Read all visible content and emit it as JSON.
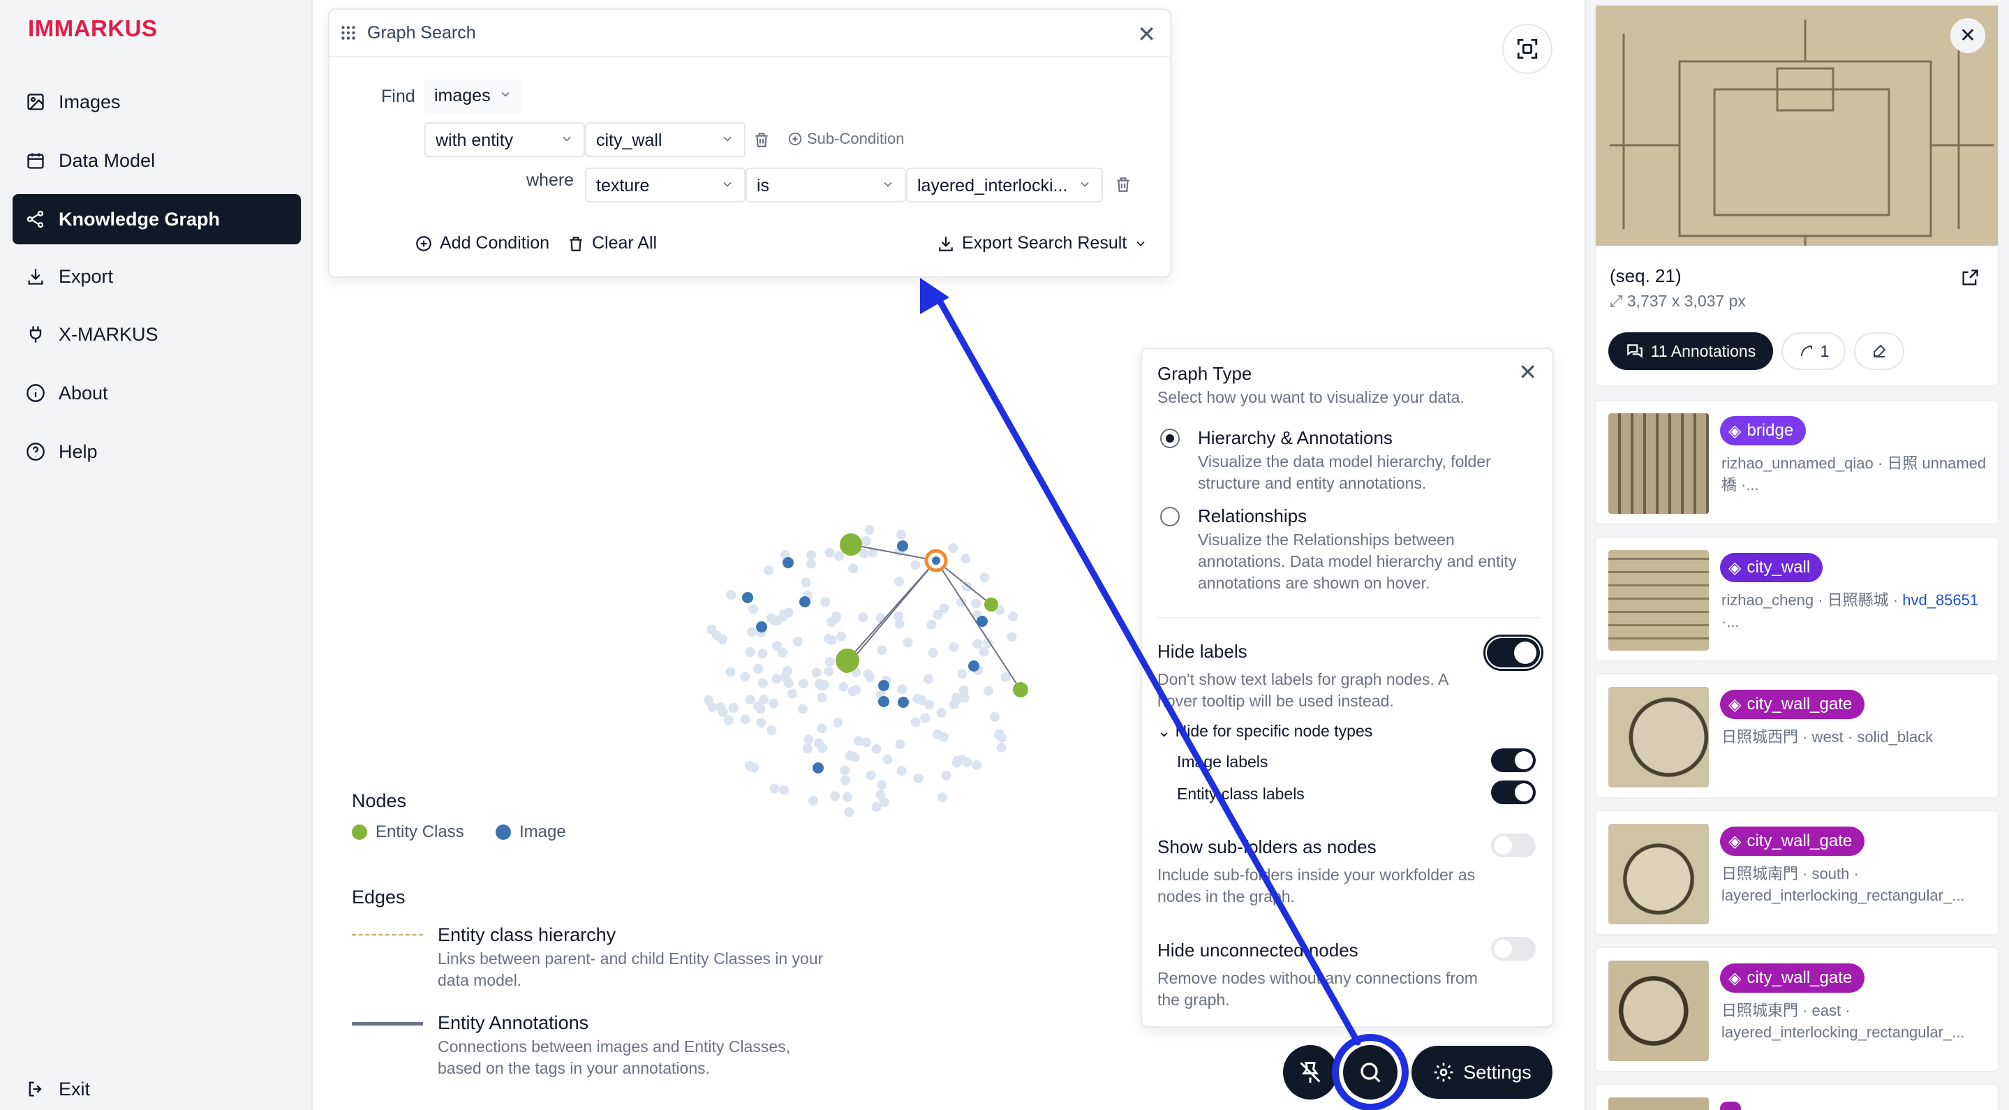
{
  "app": {
    "name": "IMMARKUS"
  },
  "sidebar": {
    "items": [
      {
        "label": "Images",
        "icon": "image-icon"
      },
      {
        "label": "Data Model",
        "icon": "calendar-icon"
      },
      {
        "label": "Knowledge Graph",
        "icon": "graph-icon",
        "active": true
      },
      {
        "label": "Export",
        "icon": "download-icon"
      },
      {
        "label": "X-MARKUS",
        "icon": "plug-icon"
      },
      {
        "label": "About",
        "icon": "info-icon"
      },
      {
        "label": "Help",
        "icon": "help-icon"
      }
    ],
    "exit_label": "Exit"
  },
  "search": {
    "title": "Graph Search",
    "find_label": "Find",
    "find_value": "images",
    "with_entity": "with entity",
    "entity_value": "city_wall",
    "sub_condition": "Sub-Condition",
    "where_label": "where",
    "property": "texture",
    "operator": "is",
    "value": "layered_interlocki...",
    "add_condition": "Add Condition",
    "clear_all": "Clear All",
    "export": "Export Search Result"
  },
  "legend": {
    "nodes_title": "Nodes",
    "entity_class": "Entity Class",
    "image": "Image",
    "edges_title": "Edges",
    "hierarchy_title": "Entity class hierarchy",
    "hierarchy_desc": "Links between parent- and child Entity Classes in your data model.",
    "annotations_title": "Entity Annotations",
    "annotations_desc": "Connections between images and Entity Classes, based on the tags in your annotations."
  },
  "graph_type": {
    "title": "Graph Type",
    "subtitle": "Select how you want to visualize your data.",
    "option1_title": "Hierarchy & Annotations",
    "option1_desc": "Visualize the data model hierarchy, folder structure and entity annotations.",
    "option2_title": "Relationships",
    "option2_desc": "Visualize the Relationships between annotations. Data model hierarchy and entity annotations are shown on hover.",
    "hide_labels_title": "Hide labels",
    "hide_labels_desc": "Don't show text labels for graph nodes. A hover tooltip will be used instead.",
    "specific_types": "Hide for specific node types",
    "image_labels": "Image labels",
    "entity_class_labels": "Entity class labels",
    "subfolders_title": "Show sub-folders as nodes",
    "subfolders_desc": "Include sub-folders inside your workfolder as nodes in the graph.",
    "unconnected_title": "Hide unconnected nodes",
    "unconnected_desc": "Remove nodes without any connections from the graph."
  },
  "controls": {
    "settings_label": "Settings"
  },
  "detail": {
    "seq": "(seq. 21)",
    "dimensions": "3,737 x 3,037 px",
    "annotations_btn": "11 Annotations",
    "relations_count": "1"
  },
  "annotations": [
    {
      "tag": "bridge",
      "color": "#7c3aed",
      "meta": "rizhao_unnamed_qiao · 日照 unnamed橋 ·..."
    },
    {
      "tag": "city_wall",
      "color": "#6d28d9",
      "meta": "rizhao_cheng · 日照縣城 · ",
      "link": "hvd_85651",
      "meta2": " ·..."
    },
    {
      "tag": "city_wall_gate",
      "color": "#a21caf",
      "meta": "日照城西門 · west · solid_black"
    },
    {
      "tag": "city_wall_gate",
      "color": "#a21caf",
      "meta": "日照城南門 · south · layered_interlocking_rectangular_..."
    },
    {
      "tag": "city_wall_gate",
      "color": "#a21caf",
      "meta": "日照城東門 · east · layered_interlocking_rectangular_..."
    }
  ],
  "colors": {
    "entity_class": "#84b53a",
    "image": "#3b73b3",
    "highlight": "#1d2fe0"
  }
}
